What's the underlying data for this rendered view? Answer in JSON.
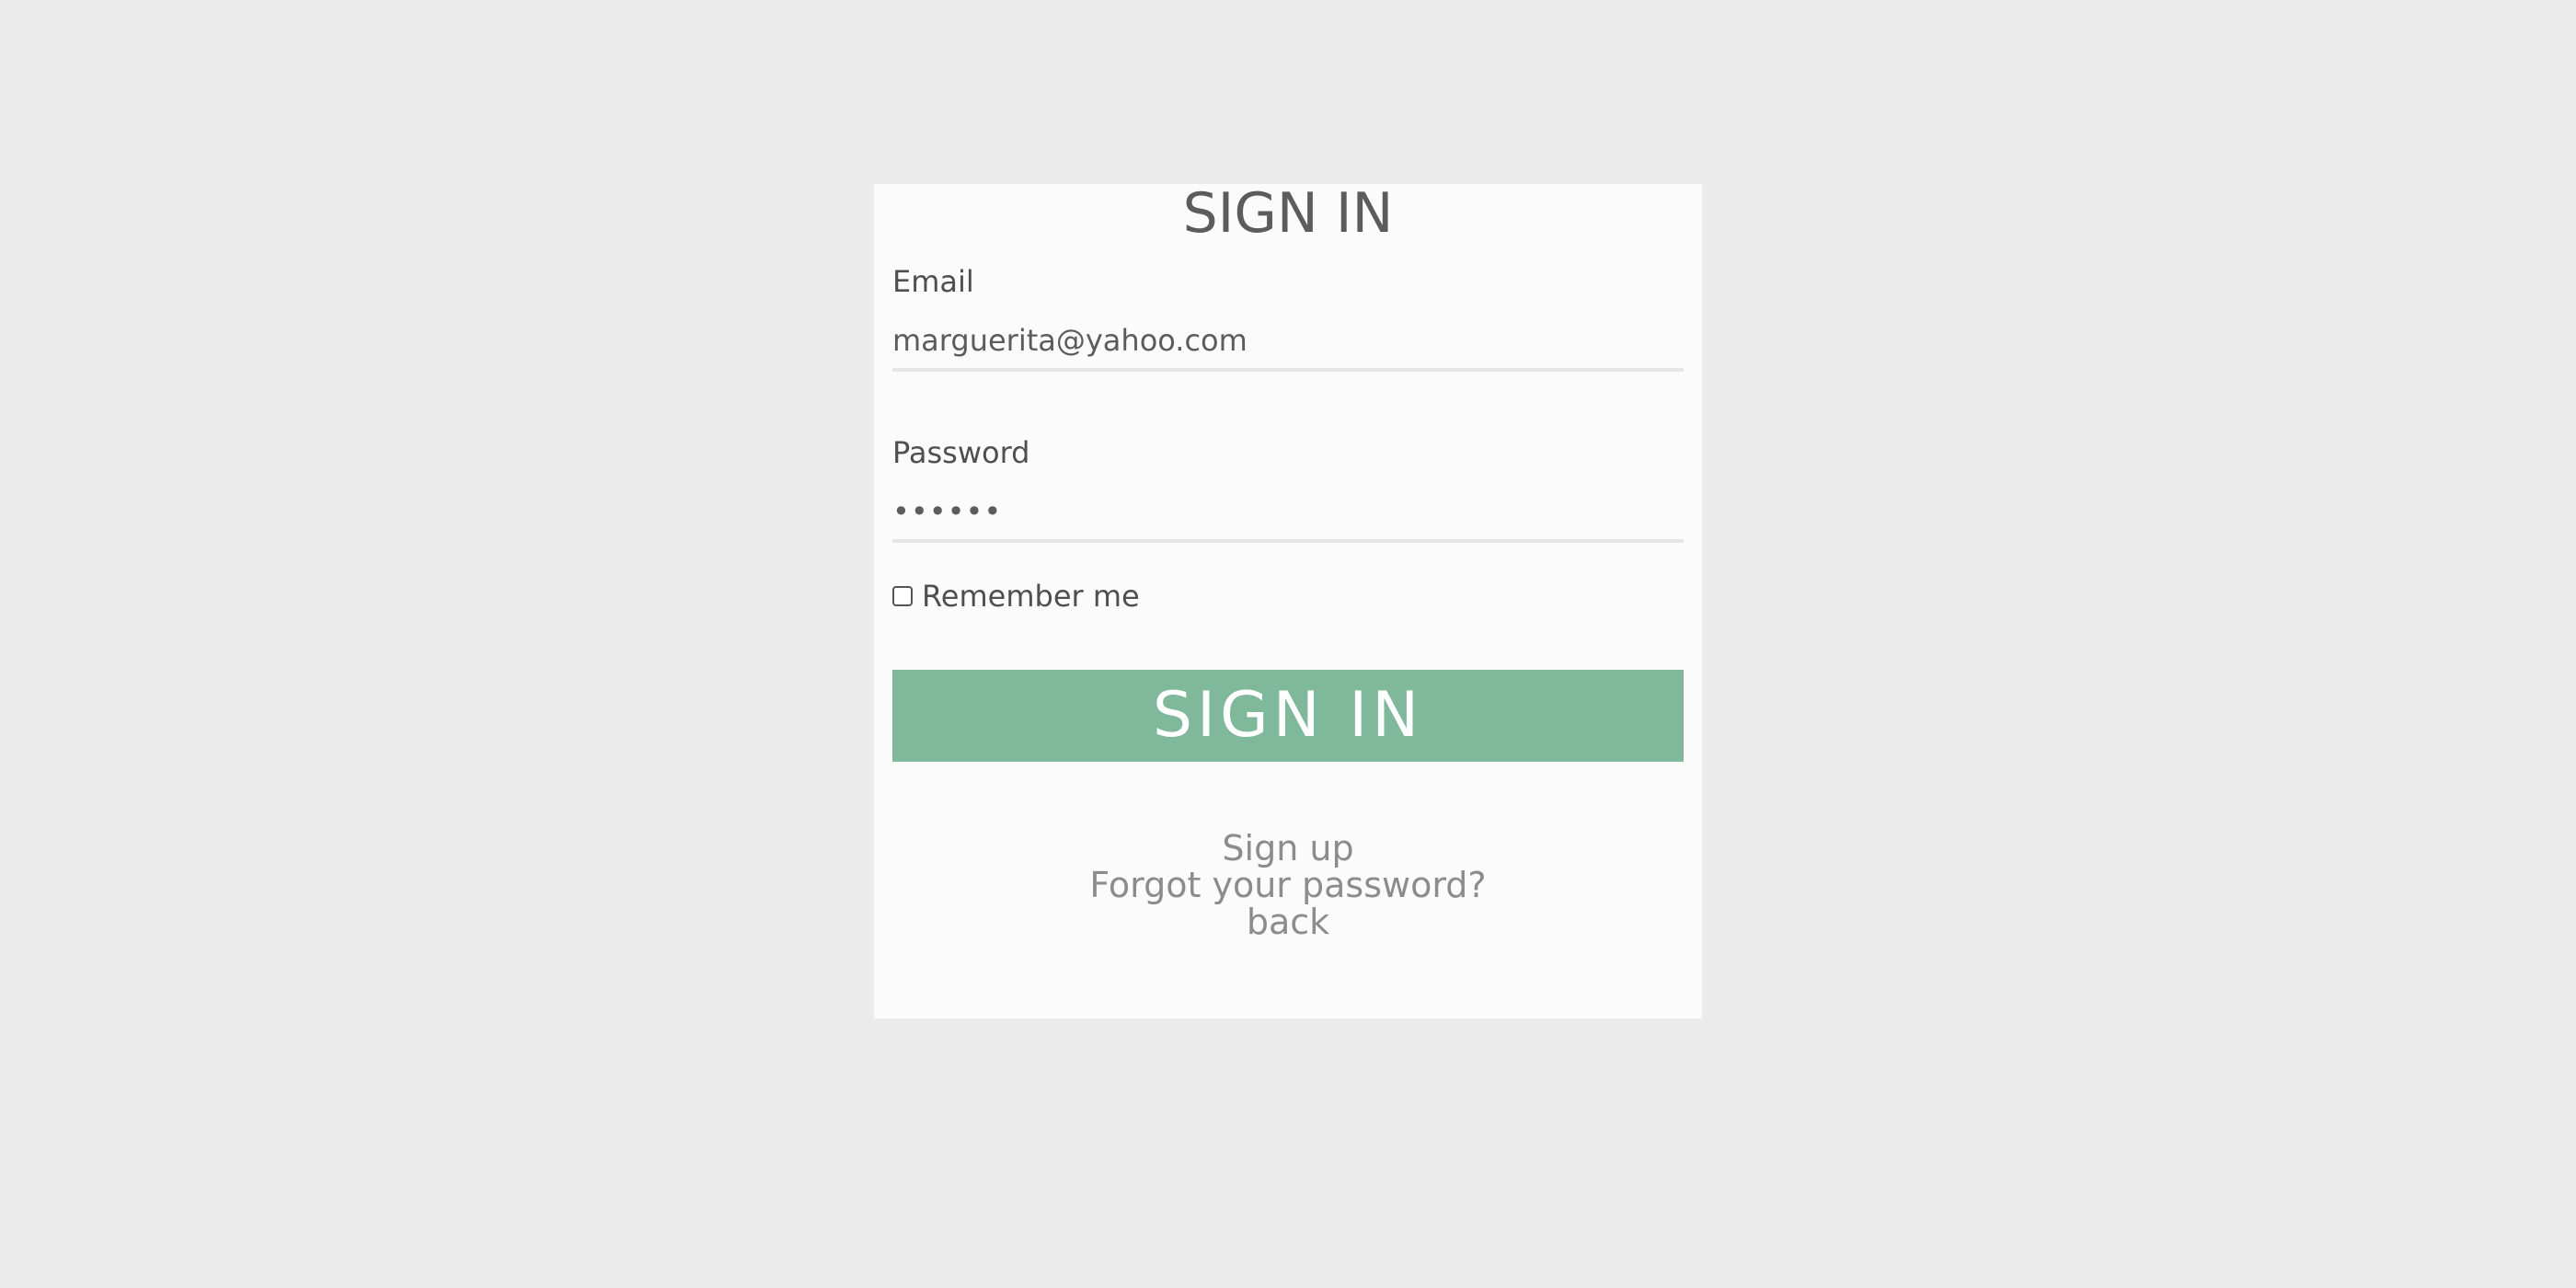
{
  "form": {
    "title": "SIGN IN",
    "email_label": "Email",
    "email_value": "marguerita@yahoo.com",
    "password_label": "Password",
    "password_value": "••••••",
    "remember_label": "Remember me",
    "remember_checked": false,
    "submit_label": "SIGN IN"
  },
  "links": {
    "signup": "Sign up",
    "forgot_password": "Forgot your password?",
    "back": "back"
  },
  "colors": {
    "background": "#ebebeb",
    "card": "#fbfbfb",
    "button": "#7fb89b",
    "link": "#8c8c8c"
  }
}
